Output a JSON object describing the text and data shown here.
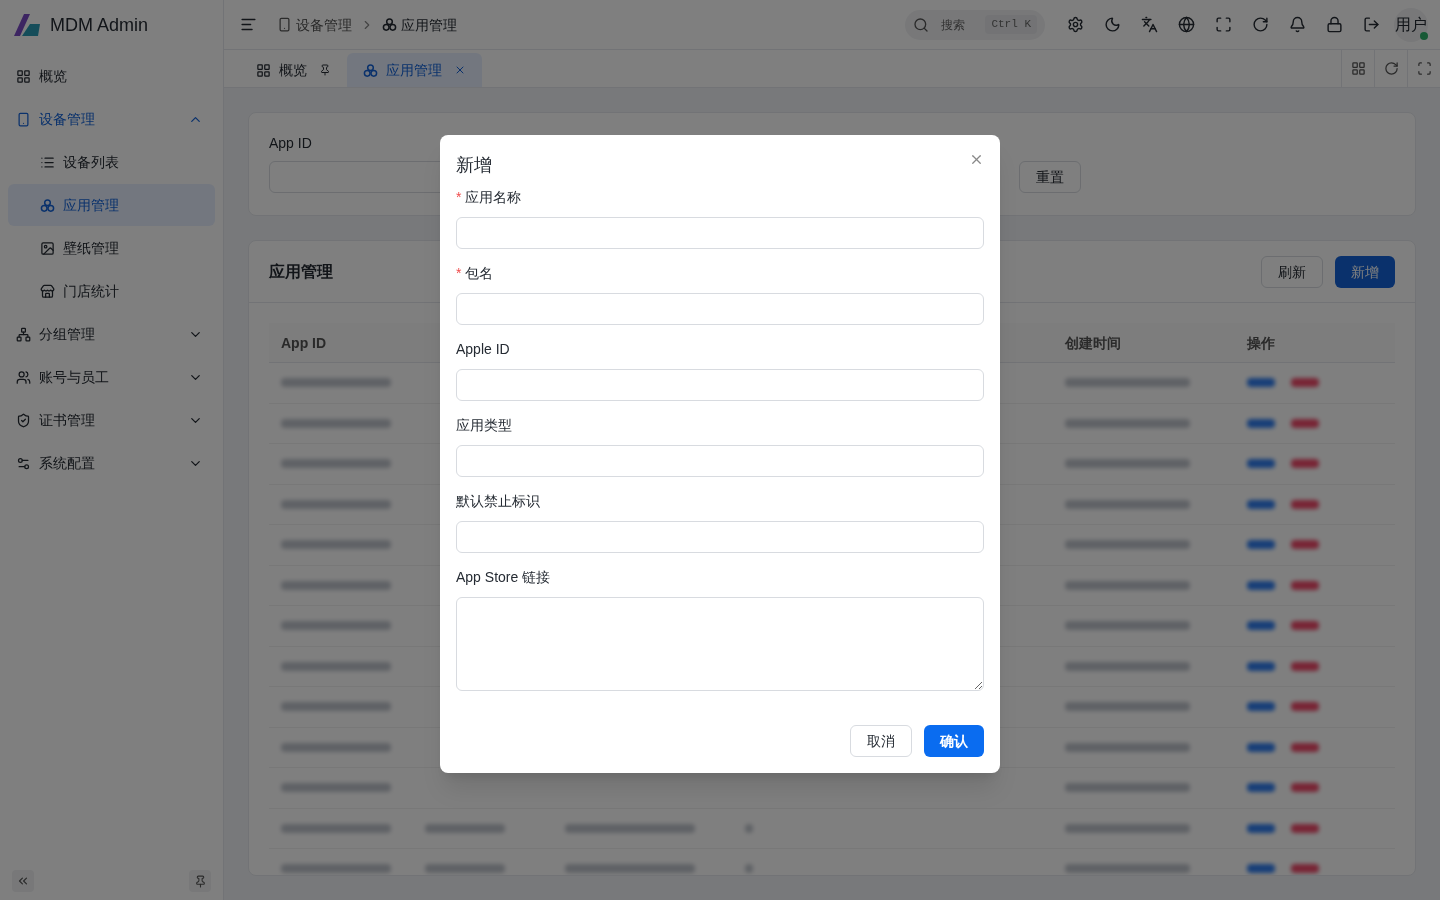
{
  "app": {
    "name": "MDM Admin"
  },
  "sidebar": {
    "items": [
      {
        "kind": "grid",
        "label": "概览",
        "selected": false
      },
      {
        "kind": "phone",
        "label": "设备管理",
        "selected": false,
        "expanded": true,
        "children": [
          {
            "kind": "list",
            "label": "设备列表",
            "selected": false
          },
          {
            "kind": "apps",
            "label": "应用管理",
            "selected": true
          },
          {
            "kind": "image",
            "label": "壁纸管理",
            "selected": false
          },
          {
            "kind": "store",
            "label": "门店统计",
            "selected": false
          }
        ]
      },
      {
        "kind": "tree",
        "label": "分组管理",
        "selected": false,
        "expanded": false
      },
      {
        "kind": "users",
        "label": "账号与员工",
        "selected": false,
        "expanded": false
      },
      {
        "kind": "shield",
        "label": "证书管理",
        "selected": false,
        "expanded": false
      },
      {
        "kind": "sliders",
        "label": "系统配置",
        "selected": false,
        "expanded": false
      }
    ]
  },
  "header": {
    "breadcrumb": [
      {
        "kind": "phone",
        "label": "设备管理"
      },
      {
        "kind": "apps",
        "label": "应用管理"
      }
    ],
    "search": {
      "placeholder": "搜索",
      "shortcut": "Ctrl K"
    },
    "user": "用户"
  },
  "tabs": [
    {
      "kind": "grid",
      "label": "概览",
      "selected": false,
      "pinned": true
    },
    {
      "kind": "apps",
      "label": "应用管理",
      "selected": true,
      "pinned": false
    }
  ],
  "filter": {
    "label": "App ID",
    "reset": "重置"
  },
  "table": {
    "title": "应用管理",
    "buttons": [
      {
        "label": "刷新",
        "kind": "default"
      },
      {
        "label": "新增",
        "kind": "primary"
      }
    ],
    "columns": [
      "App ID",
      "创建时间",
      "操作"
    ]
  },
  "modal": {
    "title": "新增",
    "fields": [
      {
        "label": "应用名称",
        "required_mark": "*",
        "kind": "input"
      },
      {
        "label": "包名",
        "required_mark": "*",
        "kind": "input"
      },
      {
        "label": "Apple ID",
        "kind": "input"
      },
      {
        "label": "应用类型",
        "kind": "input"
      },
      {
        "label": "默认禁止标识",
        "kind": "input"
      },
      {
        "label": "App Store 链接",
        "kind": "textarea"
      }
    ],
    "buttons": [
      {
        "label": "取消",
        "kind": "default"
      },
      {
        "label": "确认",
        "kind": "primary"
      }
    ]
  }
}
